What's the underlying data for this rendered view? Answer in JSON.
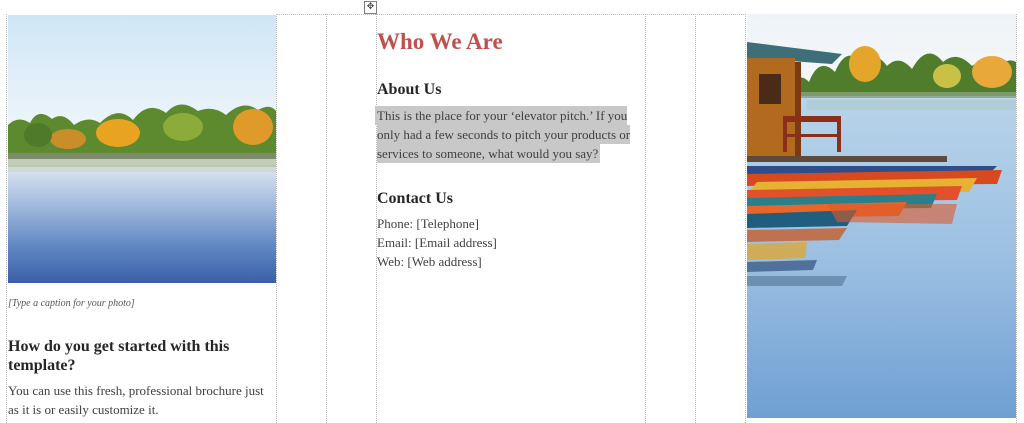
{
  "left_panel": {
    "caption": "[Type a caption for your photo]",
    "heading": "How do you get started with this template?",
    "body": "You can use this fresh, professional brochure just as it is or easily customize it."
  },
  "middle_panel": {
    "title": "Who We Are",
    "about_heading": "About Us",
    "about_text": "This is the place for your ‘elevator pitch.’ If you only had a few seconds to pitch your products or services to someone, what would you say?",
    "contact_heading": "Contact Us",
    "phone": "Phone: [Telephone]",
    "email": "Email: [Email address]",
    "web": "Web: [Web address]"
  },
  "table_move_handle": "move-handle-icon",
  "colors": {
    "title": "#c0504d",
    "highlight": "#c8c8c8"
  }
}
